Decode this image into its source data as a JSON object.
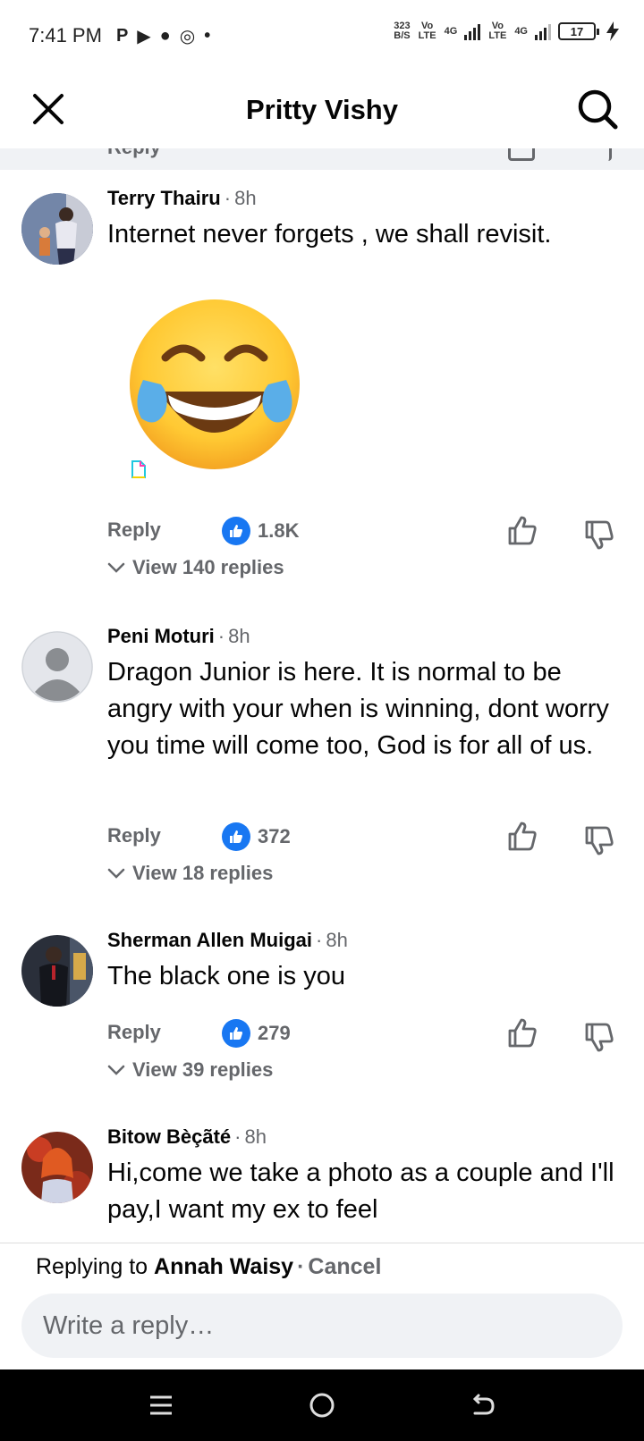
{
  "status_bar": {
    "time": "7:41 PM",
    "app_icons": [
      "P",
      "▶",
      "●",
      "◎",
      "•"
    ],
    "net_speed_value": "323",
    "net_speed_unit": "B/S",
    "sim1_label": "Vo LTE",
    "sim1_network": "4G",
    "sim2_label": "Vo LTE",
    "sim2_network": "4G",
    "battery": "17"
  },
  "header": {
    "title": "Pritty Vishy",
    "close_icon": "close-icon",
    "search_icon": "search-icon"
  },
  "partial_row": {
    "reply_label": "Reply"
  },
  "comments": [
    {
      "author": "Terry Thairu",
      "time": "8h",
      "text": "Internet never forgets , we shall revisit.",
      "sticker": "face-with-tears-of-joy-emoji",
      "reply_label": "Reply",
      "like_count": "1.8K",
      "view_replies": "View 140 replies"
    },
    {
      "author": "Peni Moturi",
      "time": "8h",
      "text": "Dragon Junior is here. It is normal to be angry with your when is winning, dont worry you time will come too, God is for all of us.",
      "reply_label": "Reply",
      "like_count": "372",
      "view_replies": "View 18 replies"
    },
    {
      "author": "Sherman Allen Muigai",
      "time": "8h",
      "text": "The black one is you",
      "reply_label": "Reply",
      "like_count": "279",
      "view_replies": "View 39 replies"
    },
    {
      "author": "Bitow Bèçãté",
      "time": "8h",
      "text": "Hi,come we take a photo as a couple and I'll pay,I want my ex to feel"
    }
  ],
  "reply_bar": {
    "prefix": "Replying to",
    "target": "Annah Waisy",
    "separator": "·",
    "cancel": "Cancel",
    "placeholder": "Write a reply…"
  },
  "colors": {
    "accent": "#1877f2",
    "muted": "#65676b",
    "text": "#050505",
    "input_bg": "#f0f2f5"
  }
}
